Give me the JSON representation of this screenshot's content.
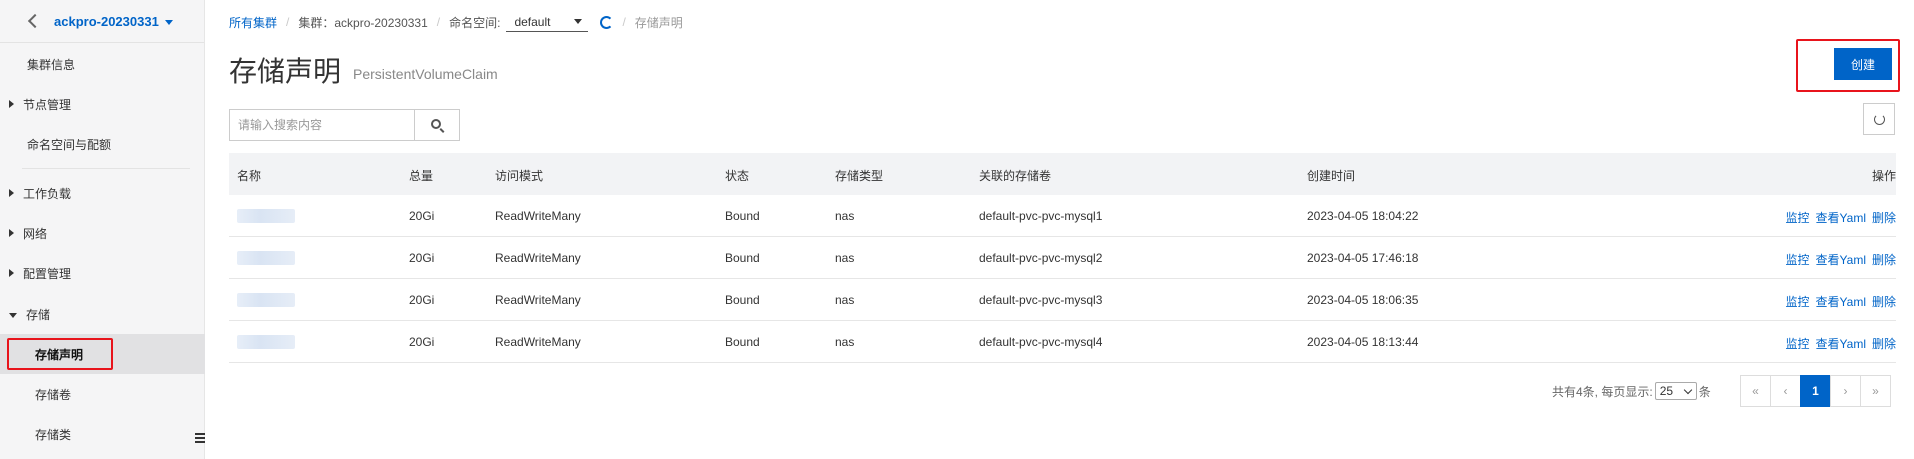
{
  "sidebar": {
    "cluster_name": "ackpro-20230331",
    "items": [
      {
        "label": "集群信息"
      },
      {
        "label": "节点管理"
      },
      {
        "label": "命名空间与配额"
      },
      {
        "label": "工作负载"
      },
      {
        "label": "网络"
      },
      {
        "label": "配置管理"
      },
      {
        "label": "存储"
      },
      {
        "label": "存储声明"
      },
      {
        "label": "存储卷"
      },
      {
        "label": "存储类"
      }
    ]
  },
  "breadcrumb": {
    "all_clusters": "所有集群",
    "cluster_label": "集群：ackpro-20230331",
    "namespace_label": "命名空间:",
    "namespace_value": "default",
    "current": "存储声明"
  },
  "page": {
    "title": "存储声明",
    "subtitle": "PersistentVolumeClaim",
    "create_label": "创建"
  },
  "search": {
    "placeholder": "请输入搜索内容"
  },
  "table": {
    "headers": {
      "name": "名称",
      "capacity": "总量",
      "access_mode": "访问模式",
      "status": "状态",
      "storage_type": "存储类型",
      "volume": "关联的存储卷",
      "created": "创建时间",
      "actions": "操作"
    },
    "action_labels": {
      "monitor": "监控",
      "yaml": "查看Yaml",
      "delete": "删除"
    },
    "rows": [
      {
        "capacity": "20Gi",
        "access_mode": "ReadWriteMany",
        "status": "Bound",
        "storage_type": "nas",
        "volume": "default-pvc-pvc-mysql1",
        "created": "2023-04-05 18:04:22"
      },
      {
        "capacity": "20Gi",
        "access_mode": "ReadWriteMany",
        "status": "Bound",
        "storage_type": "nas",
        "volume": "default-pvc-pvc-mysql2",
        "created": "2023-04-05 17:46:18"
      },
      {
        "capacity": "20Gi",
        "access_mode": "ReadWriteMany",
        "status": "Bound",
        "storage_type": "nas",
        "volume": "default-pvc-pvc-mysql3",
        "created": "2023-04-05 18:06:35"
      },
      {
        "capacity": "20Gi",
        "access_mode": "ReadWriteMany",
        "status": "Bound",
        "storage_type": "nas",
        "volume": "default-pvc-pvc-mysql4",
        "created": "2023-04-05 18:13:44"
      }
    ]
  },
  "pagination": {
    "total_text": "共有4条, 每页显示:",
    "page_size": "25",
    "unit": "条",
    "first": "«",
    "prev": "‹",
    "current_page": "1",
    "next": "›",
    "last": "»"
  },
  "colors": {
    "brand": "#0064c8",
    "highlight": "#e8141c"
  }
}
